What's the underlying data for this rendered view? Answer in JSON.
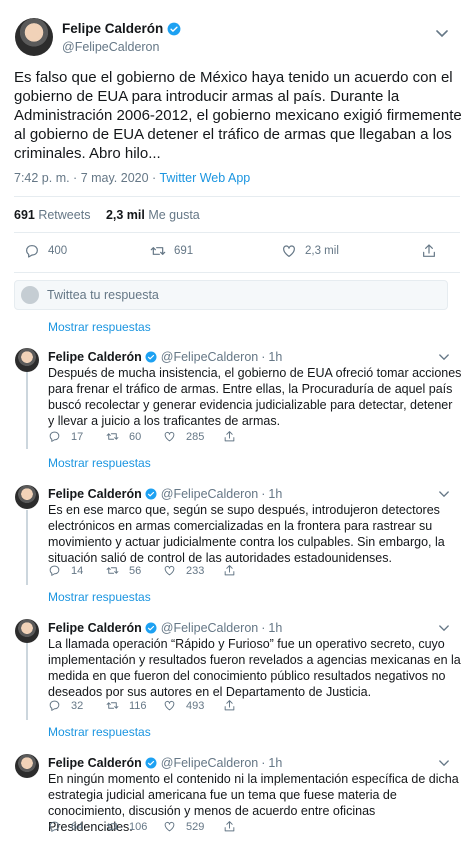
{
  "main": {
    "author_name": "Felipe Calderón",
    "author_handle": "@FelipeCalderon",
    "text": "Es falso que el gobierno de México haya tenido un acuerdo con el gobierno de EUA para introducir armas al país. Durante la Administración 2006-2012, el gobierno mexicano exigió firmemente al gobierno de EUA detener el tráfico de armas que llegaban a los criminales. Abro hilo...",
    "timestamp": "7:42 p. m. · 7 may. 2020 · ",
    "source": "Twitter Web App",
    "retweets_count": "691",
    "retweets_label": " Retweets",
    "likes_count": "2,3 mil",
    "likes_label": " Me gusta",
    "reply_count": "400",
    "retweet_count": "691",
    "like_count": "2,3 mil"
  },
  "reply_box": {
    "placeholder": "Twittea tu respuesta"
  },
  "show_replies_label": "Mostrar respuestas",
  "replies": [
    {
      "name": "Felipe Calderón",
      "handle": "@FelipeCalderon",
      "time": "1h",
      "text": "Después de mucha insistencia, el gobierno de EUA ofreció tomar acciones para frenar el tráfico de armas. Entre ellas, la Procuraduría de aquel país buscó recolectar y generar evidencia judicializable para detectar, detener y llevar a juicio a los traficantes de armas.",
      "replies": "17",
      "retweets": "60",
      "likes": "285"
    },
    {
      "name": "Felipe Calderón",
      "handle": "@FelipeCalderon",
      "time": "1h",
      "text": "Es en ese marco que, según se supo después, introdujeron detectores electrónicos en armas comercializadas en la frontera para rastrear su movimiento y actuar judicialmente contra los culpables. Sin embargo, la situación salió de control de las autoridades estadounidenses.",
      "replies": "14",
      "retweets": "56",
      "likes": "233"
    },
    {
      "name": "Felipe Calderón",
      "handle": "@FelipeCalderon",
      "time": "1h",
      "text": "La llamada operación “Rápido y Furioso” fue un operativo secreto, cuyo implementación y resultados fueron revelados a agencias mexicanas en la medida en que fueron del conocimiento público resultados negativos no deseados por sus autores en el Departamento de Justicia.",
      "replies": "32",
      "retweets": "116",
      "likes": "493"
    },
    {
      "name": "Felipe Calderón",
      "handle": "@FelipeCalderon",
      "time": "1h",
      "text": "En ningún momento el contenido ni la implementación específica de dicha estrategia judicial americana fue un tema que fuese materia de conocimiento, discusión y menos de acuerdo  entre  oficinas Presidenciales.",
      "replies": "64",
      "retweets": "106",
      "likes": "529"
    }
  ],
  "colors": {
    "link": "#1b95e0",
    "muted": "#657786",
    "verified": "#1da1f2"
  }
}
